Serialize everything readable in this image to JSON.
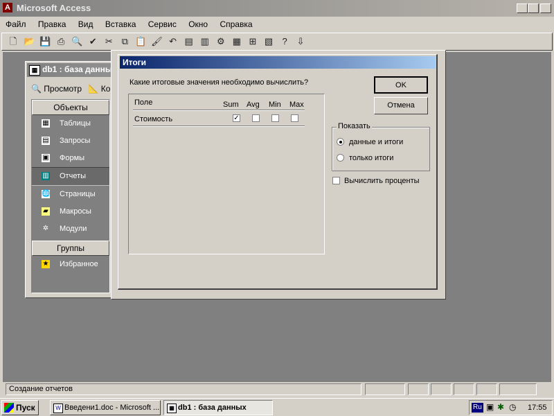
{
  "app": {
    "title": "Microsoft Access",
    "menu": [
      "Файл",
      "Правка",
      "Вид",
      "Вставка",
      "Сервис",
      "Окно",
      "Справка"
    ]
  },
  "dbwindow": {
    "title": "db1 : база данных",
    "preview_label": "Просмотр",
    "construct_label": "Ко",
    "objects_header": "Объекты",
    "groups_header": "Группы",
    "items": [
      "Таблицы",
      "Запросы",
      "Формы",
      "Отчеты",
      "Страницы",
      "Макросы",
      "Модули"
    ],
    "selected_item": "Отчеты",
    "favorites": "Избранное"
  },
  "dialog": {
    "title": "Итоги",
    "question": "Какие итоговые значения необходимо вычислить?",
    "col_field": "Поле",
    "col_sum": "Sum",
    "col_avg": "Avg",
    "col_min": "Min",
    "col_max": "Max",
    "row_field": "Стоимость",
    "row_sum_checked": true,
    "row_avg_checked": false,
    "row_min_checked": false,
    "row_max_checked": false,
    "ok_label": "OK",
    "cancel_label": "Отмена",
    "show_group_label": "Показать",
    "option_detail": "данные и итоги",
    "option_summary": "только итоги",
    "percent_label": "Вычислить проценты"
  },
  "status": {
    "text": "Создание отчетов"
  },
  "taskbar": {
    "start_label": "Пуск",
    "tasks": [
      "Введени1.doc - Microsoft ...",
      "db1 : база данных"
    ],
    "language": "Ru",
    "clock": "17:55"
  },
  "colors": {
    "desktop": "#808080",
    "title_active": "#0a246a",
    "face": "#d4d0c8"
  }
}
